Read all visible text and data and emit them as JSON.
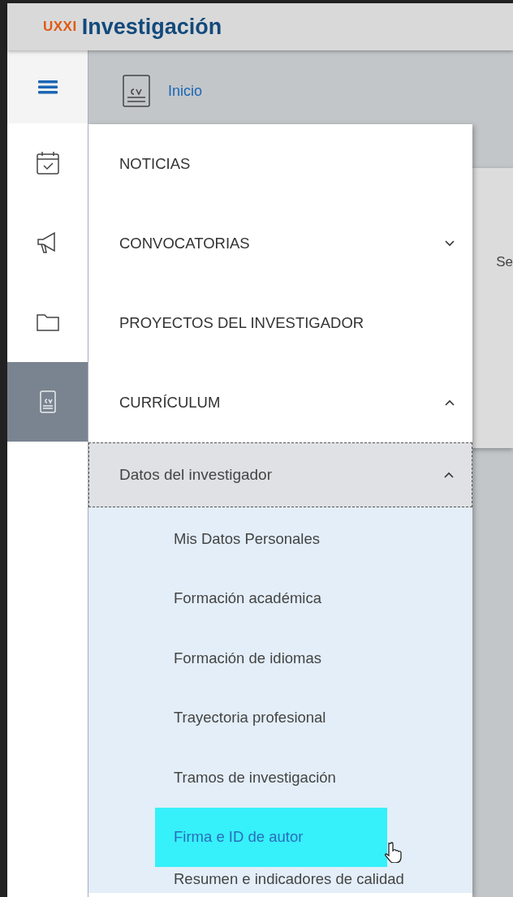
{
  "header": {
    "logo_prefix": "UXXI",
    "logo_text": "Investigación"
  },
  "breadcrumb": "Inicio",
  "content_text": "Se",
  "sidebar": {
    "items": [
      {
        "kind": "calendar",
        "selected": false
      },
      {
        "kind": "megaphone",
        "selected": false
      },
      {
        "kind": "folder",
        "selected": false
      },
      {
        "kind": "cv",
        "selected": true
      }
    ]
  },
  "menu": {
    "items": [
      {
        "label": "NOTICIAS"
      },
      {
        "label": "CONVOCATORIAS",
        "expanded": false
      },
      {
        "label": "PROYECTOS DEL INVESTIGADOR"
      },
      {
        "label": "CURRÍCULUM",
        "expanded": true,
        "children": [
          {
            "label": "Datos del investigador",
            "expanded": true,
            "children": [
              {
                "label": "Mis Datos Personales",
                "selected": false
              },
              {
                "label": "Formación académica",
                "selected": false
              },
              {
                "label": "Formación de idiomas",
                "selected": false
              },
              {
                "label": "Trayectoria profesional",
                "selected": false
              },
              {
                "label": "Tramos de investigación",
                "selected": false
              },
              {
                "label": "Firma e ID de autor",
                "selected": true
              },
              {
                "label": "Resumen e indicadores de calidad",
                "selected": false
              }
            ]
          }
        ]
      }
    ]
  }
}
